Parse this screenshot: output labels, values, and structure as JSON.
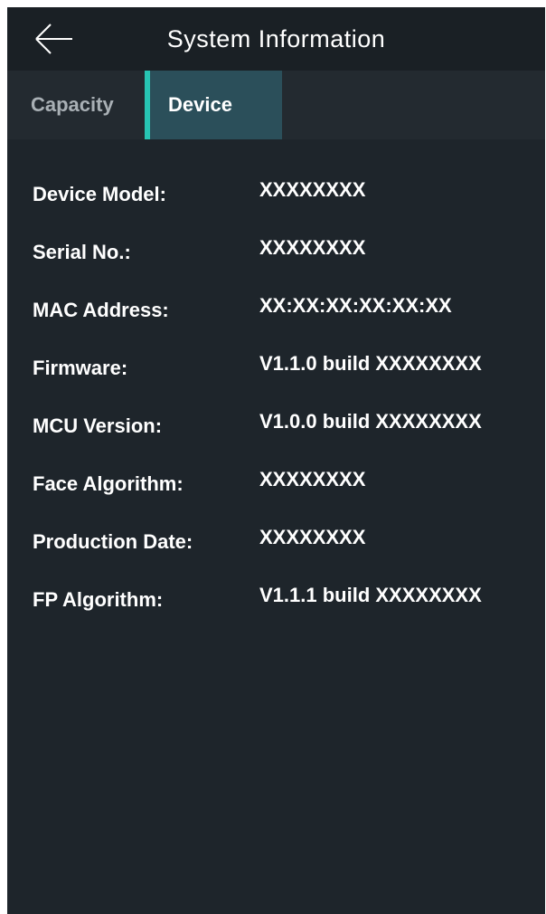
{
  "header": {
    "title": "System Information",
    "back_icon": "arrow-left-icon"
  },
  "tabs": [
    {
      "label": "Capacity",
      "active": false
    },
    {
      "label": "Device",
      "active": true
    }
  ],
  "colors": {
    "background": "#1e252b",
    "active_tab": "#2b4f5a",
    "accent": "#27c4b3"
  },
  "device_info": [
    {
      "label": "Device Model:",
      "value": "XXXXXXXX"
    },
    {
      "label": "Serial No.:",
      "value": "XXXXXXXX"
    },
    {
      "label": "MAC Address:",
      "value": "XX:XX:XX:XX:XX:XX"
    },
    {
      "label": "Firmware:",
      "value": "V1.1.0 build XXXXXXXX"
    },
    {
      "label": "MCU Version:",
      "value": "V1.0.0 build XXXXXXXX"
    },
    {
      "label": "Face Algorithm:",
      "value": "XXXXXXXX"
    },
    {
      "label": "Production Date:",
      "value": "XXXXXXXX"
    },
    {
      "label": "FP Algorithm:",
      "value": "V1.1.1 build XXXXXXXX"
    }
  ]
}
